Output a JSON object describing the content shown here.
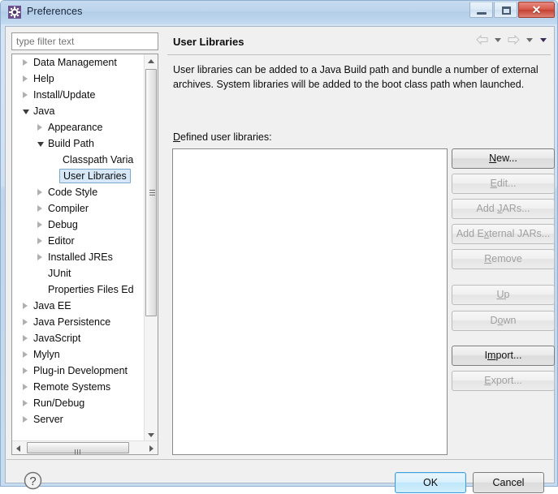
{
  "window": {
    "title": "Preferences",
    "icon": "gear-icon",
    "controls": {
      "minimize": "minimize-icon",
      "maximize": "maximize-icon",
      "close": "✕"
    }
  },
  "sidebar": {
    "filter": {
      "placeholder": "type filter text",
      "value": ""
    },
    "tree": [
      {
        "label": "Data Management",
        "indent": 0,
        "state": "collapsed"
      },
      {
        "label": "Help",
        "indent": 0,
        "state": "collapsed"
      },
      {
        "label": "Install/Update",
        "indent": 0,
        "state": "collapsed"
      },
      {
        "label": "Java",
        "indent": 0,
        "state": "expanded"
      },
      {
        "label": "Appearance",
        "indent": 1,
        "state": "collapsed"
      },
      {
        "label": "Build Path",
        "indent": 1,
        "state": "expanded"
      },
      {
        "label": "Classpath Varia",
        "indent": 2,
        "state": "leaf"
      },
      {
        "label": "User Libraries",
        "indent": 2,
        "state": "leaf",
        "selected": true
      },
      {
        "label": "Code Style",
        "indent": 1,
        "state": "collapsed"
      },
      {
        "label": "Compiler",
        "indent": 1,
        "state": "collapsed"
      },
      {
        "label": "Debug",
        "indent": 1,
        "state": "collapsed"
      },
      {
        "label": "Editor",
        "indent": 1,
        "state": "collapsed"
      },
      {
        "label": "Installed JREs",
        "indent": 1,
        "state": "collapsed"
      },
      {
        "label": "JUnit",
        "indent": 1,
        "state": "leaf"
      },
      {
        "label": "Properties Files Ed",
        "indent": 1,
        "state": "leaf"
      },
      {
        "label": "Java EE",
        "indent": 0,
        "state": "collapsed"
      },
      {
        "label": "Java Persistence",
        "indent": 0,
        "state": "collapsed"
      },
      {
        "label": "JavaScript",
        "indent": 0,
        "state": "collapsed"
      },
      {
        "label": "Mylyn",
        "indent": 0,
        "state": "collapsed"
      },
      {
        "label": "Plug-in Development",
        "indent": 0,
        "state": "collapsed"
      },
      {
        "label": "Remote Systems",
        "indent": 0,
        "state": "collapsed"
      },
      {
        "label": "Run/Debug",
        "indent": 0,
        "state": "collapsed"
      },
      {
        "label": "Server",
        "indent": 0,
        "state": "collapsed"
      }
    ]
  },
  "page": {
    "title": "User Libraries",
    "description": "User libraries can be added to a Java Build path and bundle a number of external archives. System libraries will be added to the boot class path when launched.",
    "defined_label": "Defined user libraries:",
    "defined_label_mnemonic": "D",
    "list_items": [],
    "nav": {
      "back": "back-arrow-icon",
      "back_menu": "chevron-down-icon",
      "forward": "forward-arrow-icon",
      "forward_menu": "chevron-down-icon",
      "view_menu": "chevron-down-icon"
    },
    "buttons": [
      {
        "label": "New...",
        "mnemonic": "N",
        "enabled": true
      },
      {
        "label": "Edit...",
        "mnemonic": "E",
        "enabled": false
      },
      {
        "label": "Add JARs...",
        "mnemonic": "J",
        "enabled": false
      },
      {
        "label": "Add External JARs...",
        "mnemonic": "x",
        "enabled": false
      },
      {
        "label": "Remove",
        "mnemonic": "R",
        "enabled": false
      },
      {
        "label": "Up",
        "mnemonic": "U",
        "enabled": false
      },
      {
        "label": "Down",
        "mnemonic": "o",
        "enabled": false
      },
      {
        "label": "Import...",
        "mnemonic": "m",
        "enabled": true
      },
      {
        "label": "Export...",
        "mnemonic": "E",
        "enabled": false
      }
    ]
  },
  "footer": {
    "help": "?",
    "ok": "OK",
    "cancel": "Cancel"
  },
  "colors": {
    "titlebar": "#bcd4ec",
    "dialog_bg": "#f0f0f0",
    "selection_fill": "#d7e9f8",
    "selection_border": "#7aa7cc",
    "default_button_border": "#3c9ddb",
    "close_button": "#c33f30"
  }
}
